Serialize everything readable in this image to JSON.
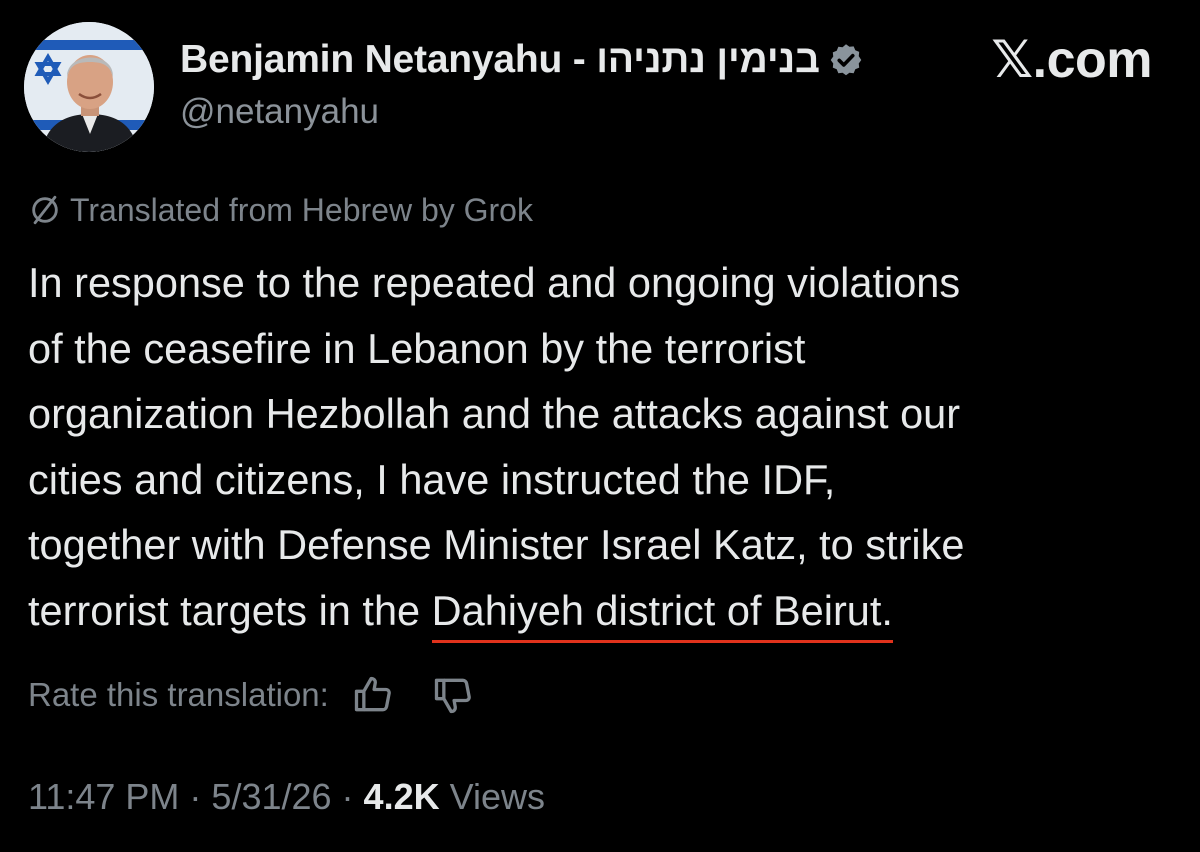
{
  "author": {
    "display_name": "Benjamin Netanyahu - בנימין נתניהו",
    "handle": "@netanyahu",
    "verified": true,
    "avatar_icon": "profile-photo",
    "verified_icon": "verified-badge-icon"
  },
  "brand": {
    "x_mark": "𝕏",
    "suffix": ".com"
  },
  "translation": {
    "notice": "Translated from Hebrew by Grok",
    "notice_icon": "slashed-circle-icon",
    "rate_label": "Rate this translation:",
    "thumbs_up_icon": "thumbs-up-icon",
    "thumbs_down_icon": "thumbs-down-icon"
  },
  "post": {
    "lines": [
      "In response to the repeated and ongoing violations",
      "of the ceasefire in Lebanon by the terrorist",
      "organization Hezbollah and the attacks against our",
      "cities and citizens, I have instructed the IDF,",
      "together with Defense Minister Israel Katz, to strike"
    ],
    "last_line_prefix": "terrorist targets in the ",
    "last_line_highlight": "Dahiyeh district of Beirut.",
    "highlight_color": "#e0321c"
  },
  "meta": {
    "time": "11:47 PM",
    "separator": " · ",
    "date": "5/31/26",
    "views_count": "4.2K",
    "views_label": " Views"
  },
  "colors": {
    "background": "#000000",
    "primary_text": "#e7e9ea",
    "secondary_text": "#7d848b",
    "verified_badge": "#8a949c"
  }
}
